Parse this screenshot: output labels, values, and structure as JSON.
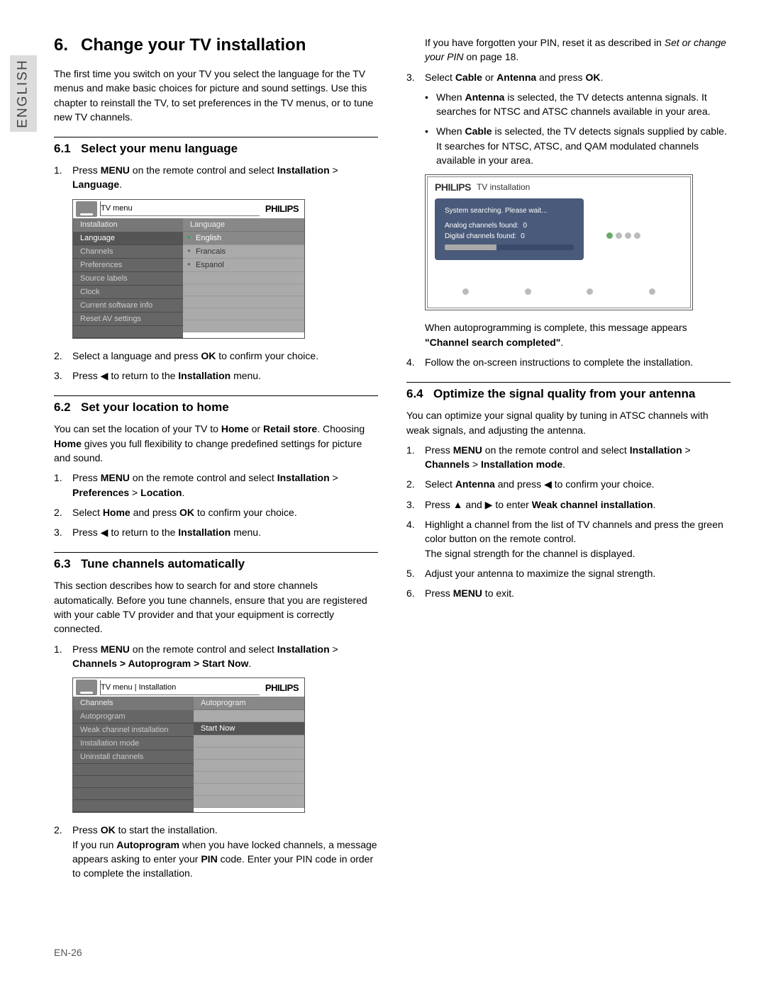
{
  "langtab": "ENGLISH",
  "title": {
    "num": "6.",
    "text": "Change your TV installation"
  },
  "intro": "The first time you switch on your TV you select the language for the TV menus and make basic choices for picture and sound settings.  Use this chapter to reinstall the TV, to set preferences in the TV menus, or to tune new TV channels.",
  "s61": {
    "num": "6.1",
    "title": "Select your menu language",
    "step1a": "Press ",
    "step1b": "MENU",
    "step1c": " on the remote control and select ",
    "step1d": "Installation",
    "step1e": " > ",
    "step1f": "Language",
    "step1g": ".",
    "step2a": "Select a language and press ",
    "step2b": "OK",
    "step2c": " to confirm your choice.",
    "step3a": "Press ◀ to return to the ",
    "step3b": "Installation",
    "step3c": " menu."
  },
  "fig1": {
    "brand": "PHILIPS",
    "crumb": "TV menu",
    "left_header": "Installation",
    "right_header": "Language",
    "left": [
      "Language",
      "Channels",
      "Preferences",
      "Source labels",
      "Clock",
      "Current software info",
      "Reset AV settings"
    ],
    "right": [
      "English",
      "Francais",
      "Espanol"
    ]
  },
  "s62": {
    "num": "6.2",
    "title": "Set your location to home",
    "p1a": "You can set the location of your TV to ",
    "p1b": "Home",
    "p1c": " or ",
    "p1d": "Retail store",
    "p1e": ".  Choosing ",
    "p1f": "Home",
    "p1g": " gives you full flexibility to change predefined settings for picture and sound.",
    "step1a": "Press ",
    "step1b": "MENU",
    "step1c": " on the remote control and select ",
    "step1d": "Installation",
    "step1e": " > ",
    "step1f": "Preferences",
    "step1g": " > ",
    "step1h": "Location",
    "step1i": ".",
    "step2a": "Select ",
    "step2b": "Home",
    "step2c": " and press ",
    "step2d": "OK",
    "step2e": " to confirm your choice.",
    "step3a": "Press ◀ to return to the ",
    "step3b": "Installation",
    "step3c": " menu."
  },
  "s63": {
    "num": "6.3",
    "title": "Tune channels automatically",
    "p1": "This section describes how to search for and store channels automatically.  Before you tune channels, ensure that you are registered with your cable TV provider and that your equipment is correctly connected.",
    "step1a": "Press ",
    "step1b": "MENU",
    "step1c": " on the remote control and select ",
    "step1d": "Installation",
    "step1e": " > ",
    "step1f": "Channels > Autoprogram > Start Now",
    "step1g": ".",
    "step2a": "Press ",
    "step2b": "OK",
    "step2c": " to start the installation.",
    "step2cont_a": "If you run ",
    "step2cont_b": "Autoprogram",
    "step2cont_c": " when you have locked channels, a message appears asking to enter your ",
    "step2cont_d": "PIN",
    "step2cont_e": " code.  Enter your PIN code in order to complete the installation."
  },
  "fig2": {
    "brand": "PHILIPS",
    "crumb": "TV menu | Installation",
    "left_header": "Channels",
    "right_header": "Autoprogram",
    "left": [
      "Autoprogram",
      "Weak channel installation",
      "Installation mode",
      "Uninstall channels"
    ],
    "right_sel": "Start Now"
  },
  "r_top": {
    "p1a": "If you have forgotten your PIN, reset it as described in ",
    "p1b": "Set or change your PIN",
    "p1c": " on page 18.",
    "step3a": "Select ",
    "step3b": "Cable",
    "step3c": " or ",
    "step3d": "Antenna",
    "step3e": " and press ",
    "step3f": "OK",
    "step3g": ".",
    "bul1a": "When ",
    "bul1b": "Antenna",
    "bul1c": " is selected, the TV detects antenna signals.  It searches for NTSC and ATSC channels available in your area.",
    "bul2a": "When ",
    "bul2b": "Cable",
    "bul2c": " is selected, the TV detects signals supplied by cable. It searches for NTSC, ATSC, and QAM modulated channels available in your area."
  },
  "fig3": {
    "brand": "PHILIPS",
    "title": "TV installation",
    "searching": "System searching. Please wait...",
    "analog_label": "Analog channels found:",
    "analog_val": "0",
    "digital_label": "Digital channels found:",
    "digital_val": "0"
  },
  "r_after_fig": {
    "cap_a": "When autoprogramming is complete, this message appears ",
    "cap_b": "\"Channel search completed\"",
    "cap_c": ".",
    "step4": "Follow the on-screen instructions to complete the installation."
  },
  "s64": {
    "num": "6.4",
    "title": "Optimize the signal quality from your antenna",
    "p1": "You can optimize your signal quality by tuning in ATSC channels with weak signals, and adjusting the antenna.",
    "step1a": "Press ",
    "step1b": "MENU",
    "step1c": " on the remote control and select ",
    "step1d": "Installation",
    "step1e": " > ",
    "step1f": "Channels",
    "step1g": " > ",
    "step1h": "Installation mode",
    "step1i": ".",
    "step2a": "Select ",
    "step2b": "Antenna",
    "step2c": " and press ◀ to confirm your choice.",
    "step3a": "Press ▲ and ▶ to enter ",
    "step3b": "Weak channel installation",
    "step3c": ".",
    "step4a": "Highlight a channel from the list of TV channels and press the green color button on the remote control.",
    "step4b": "The signal strength for the channel is displayed.",
    "step5": "Adjust your antenna to maximize the signal strength.",
    "step6a": "Press ",
    "step6b": "MENU",
    "step6c": " to exit."
  },
  "footer": "EN-26"
}
